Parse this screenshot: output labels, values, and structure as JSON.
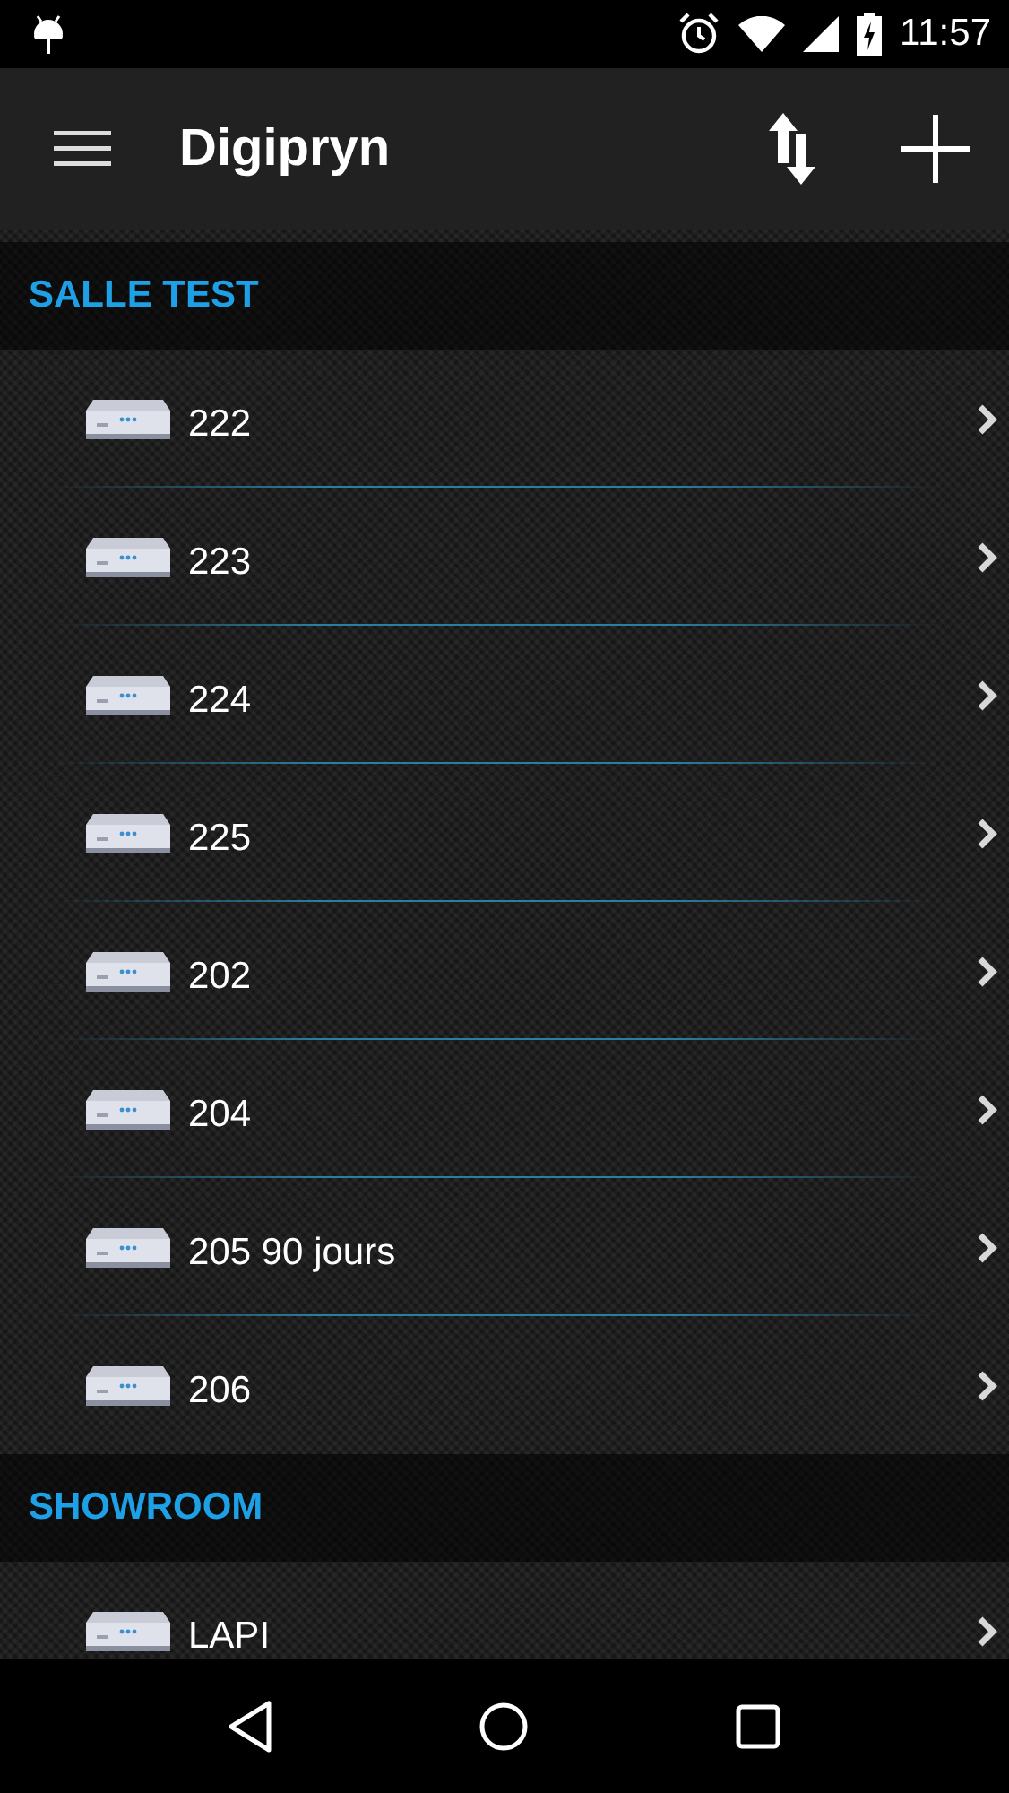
{
  "status_bar": {
    "time": "11:57"
  },
  "app_bar": {
    "title": "Digipryn"
  },
  "sections": [
    {
      "title": "SALLE TEST",
      "items": [
        {
          "label": "222"
        },
        {
          "label": "223"
        },
        {
          "label": "224"
        },
        {
          "label": "225"
        },
        {
          "label": "202"
        },
        {
          "label": "204"
        },
        {
          "label": "205 90 jours"
        },
        {
          "label": "206"
        }
      ]
    },
    {
      "title": "SHOWROOM",
      "items": [
        {
          "label": "LAPI"
        }
      ]
    }
  ]
}
